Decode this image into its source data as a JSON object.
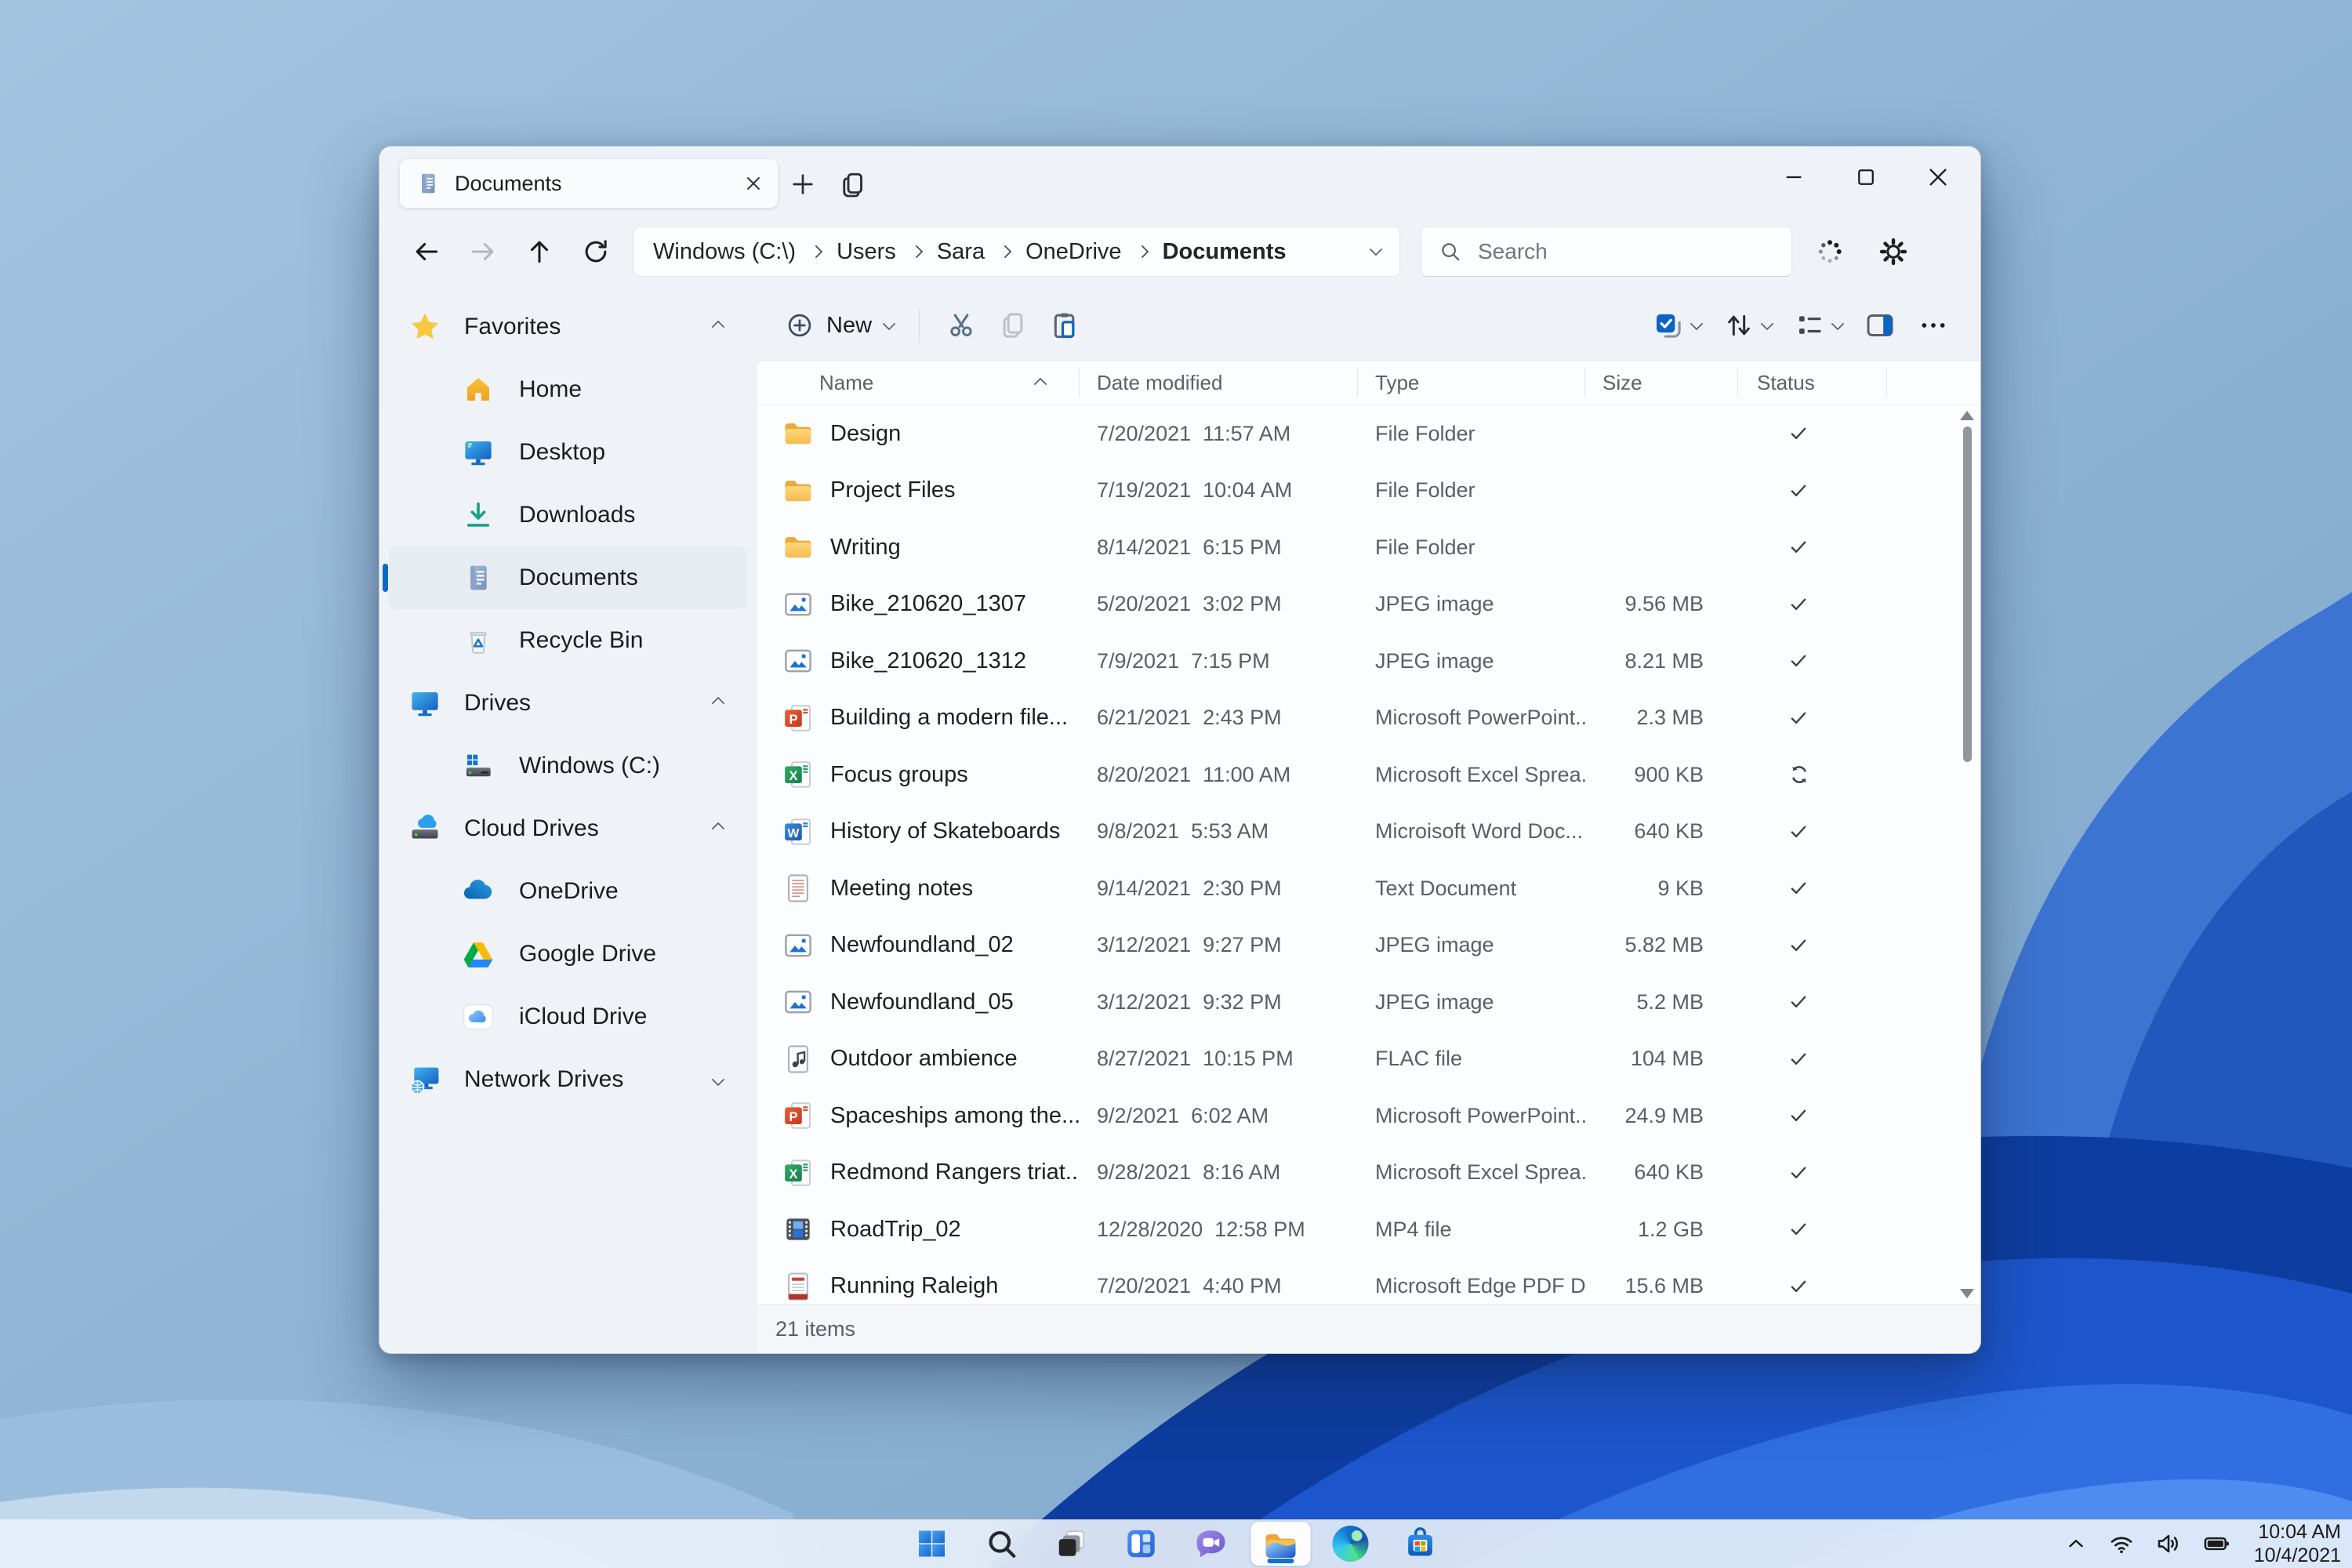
{
  "colors": {
    "accent": "#0b6ac4",
    "selection_bg": "#e7ecf2",
    "window_bg": "#eff3f8"
  },
  "window": {
    "tab_title": "Documents",
    "controls": [
      "minimize",
      "maximize",
      "close"
    ]
  },
  "address": {
    "nav": [
      "back",
      "forward",
      "up",
      "refresh"
    ],
    "breadcrumb": [
      "Windows (C:\\)",
      "Users",
      "Sara",
      "OneDrive",
      "Documents"
    ],
    "search_placeholder": "Search",
    "right_icons": [
      "sync-progress",
      "settings-gear"
    ]
  },
  "sidebar": {
    "sections": [
      {
        "label": "Favorites",
        "icon": "star-icon",
        "expanded": true,
        "items": [
          {
            "label": "Home",
            "icon": "home-icon",
            "selected": false
          },
          {
            "label": "Desktop",
            "icon": "desktop-icon",
            "selected": false
          },
          {
            "label": "Downloads",
            "icon": "downloads-icon",
            "selected": false
          },
          {
            "label": "Documents",
            "icon": "document-icon",
            "selected": true
          },
          {
            "label": "Recycle Bin",
            "icon": "recycle-bin-icon",
            "selected": false
          }
        ]
      },
      {
        "label": "Drives",
        "icon": "monitor-icon",
        "expanded": true,
        "items": [
          {
            "label": "Windows (C:)",
            "icon": "hard-drive-icon",
            "selected": false
          }
        ]
      },
      {
        "label": "Cloud Drives",
        "icon": "cloud-drive-icon",
        "expanded": true,
        "items": [
          {
            "label": "OneDrive",
            "icon": "onedrive-icon",
            "selected": false
          },
          {
            "label": "Google Drive",
            "icon": "google-drive-icon",
            "selected": false
          },
          {
            "label": "iCloud Drive",
            "icon": "icloud-icon",
            "selected": false
          }
        ]
      },
      {
        "label": "Network Drives",
        "icon": "network-icon",
        "expanded": false,
        "items": []
      }
    ]
  },
  "toolbar": {
    "new_label": "New",
    "left_icons": [
      "plus-circle",
      "cut-scissors",
      "copy",
      "paste-clipboard"
    ],
    "right_icons": [
      "select-all-checkbox",
      "sort-arrows",
      "view-list",
      "details-pane",
      "more-ellipsis"
    ]
  },
  "list": {
    "columns": [
      "Name",
      "Date modified",
      "Type",
      "Size",
      "Status"
    ],
    "sorted_column": "Name",
    "item_count": "21 items",
    "rows": [
      {
        "name": "Design",
        "icon": "folder",
        "date": "7/20/2021  11:57 AM",
        "type": "File Folder",
        "size": "",
        "status": "synced"
      },
      {
        "name": "Project Files",
        "icon": "folder",
        "date": "7/19/2021  10:04 AM",
        "type": "File Folder",
        "size": "",
        "status": "synced"
      },
      {
        "name": "Writing",
        "icon": "folder",
        "date": "8/14/2021  6:15 PM",
        "type": "File Folder",
        "size": "",
        "status": "synced"
      },
      {
        "name": "Bike_210620_1307",
        "icon": "image",
        "date": "5/20/2021  3:02 PM",
        "type": "JPEG image",
        "size": "9.56 MB",
        "status": "synced"
      },
      {
        "name": "Bike_210620_1312",
        "icon": "image",
        "date": "7/9/2021  7:15 PM",
        "type": "JPEG image",
        "size": "8.21 MB",
        "status": "synced"
      },
      {
        "name": "Building a modern file...",
        "icon": "powerpoint",
        "date": "6/21/2021  2:43 PM",
        "type": "Microsoft PowerPoint...",
        "size": "2.3 MB",
        "status": "synced"
      },
      {
        "name": "Focus groups",
        "icon": "excel",
        "date": "8/20/2021  11:00 AM",
        "type": "Microsoft Excel Sprea...",
        "size": "900 KB",
        "status": "syncing"
      },
      {
        "name": "History of Skateboards",
        "icon": "word",
        "date": "9/8/2021  5:53 AM",
        "type": "Microisoft Word Doc...",
        "size": "640 KB",
        "status": "synced"
      },
      {
        "name": "Meeting notes",
        "icon": "text",
        "date": "9/14/2021  2:30 PM",
        "type": "Text Document",
        "size": "9 KB",
        "status": "synced"
      },
      {
        "name": "Newfoundland_02",
        "icon": "image",
        "date": "3/12/2021  9:27 PM",
        "type": "JPEG image",
        "size": "5.82 MB",
        "status": "synced"
      },
      {
        "name": "Newfoundland_05",
        "icon": "image",
        "date": "3/12/2021  9:32 PM",
        "type": "JPEG image",
        "size": "5.2 MB",
        "status": "synced"
      },
      {
        "name": "Outdoor ambience",
        "icon": "audio",
        "date": "8/27/2021  10:15 PM",
        "type": "FLAC file",
        "size": "104 MB",
        "status": "synced"
      },
      {
        "name": "Spaceships among the...",
        "icon": "powerpoint",
        "date": "9/2/2021  6:02 AM",
        "type": "Microsoft PowerPoint...",
        "size": "24.9 MB",
        "status": "synced"
      },
      {
        "name": "Redmond Rangers triat...",
        "icon": "excel",
        "date": "9/28/2021  8:16 AM",
        "type": "Microsoft Excel Sprea...",
        "size": "640 KB",
        "status": "synced"
      },
      {
        "name": "RoadTrip_02",
        "icon": "video",
        "date": "12/28/2020  12:58 PM",
        "type": "MP4 file",
        "size": "1.2 GB",
        "status": "synced"
      },
      {
        "name": "Running Raleigh",
        "icon": "pdf",
        "date": "7/20/2021  4:40 PM",
        "type": "Microsoft Edge PDF D...",
        "size": "15.6 MB",
        "status": "synced"
      }
    ]
  },
  "taskbar": {
    "items": [
      {
        "icon": "start-icon",
        "active": false
      },
      {
        "icon": "search-icon",
        "active": false
      },
      {
        "icon": "task-view-icon",
        "active": false
      },
      {
        "icon": "widgets-icon",
        "active": false
      },
      {
        "icon": "chat-icon",
        "active": false
      },
      {
        "icon": "file-explorer-icon",
        "active": true
      },
      {
        "icon": "edge-icon",
        "active": false
      },
      {
        "icon": "store-icon",
        "active": false
      }
    ]
  },
  "tray": {
    "icons": [
      "hidden-icons-chevron",
      "wifi",
      "volume",
      "battery"
    ],
    "time": "10:04 AM",
    "date": "10/4/2021"
  }
}
